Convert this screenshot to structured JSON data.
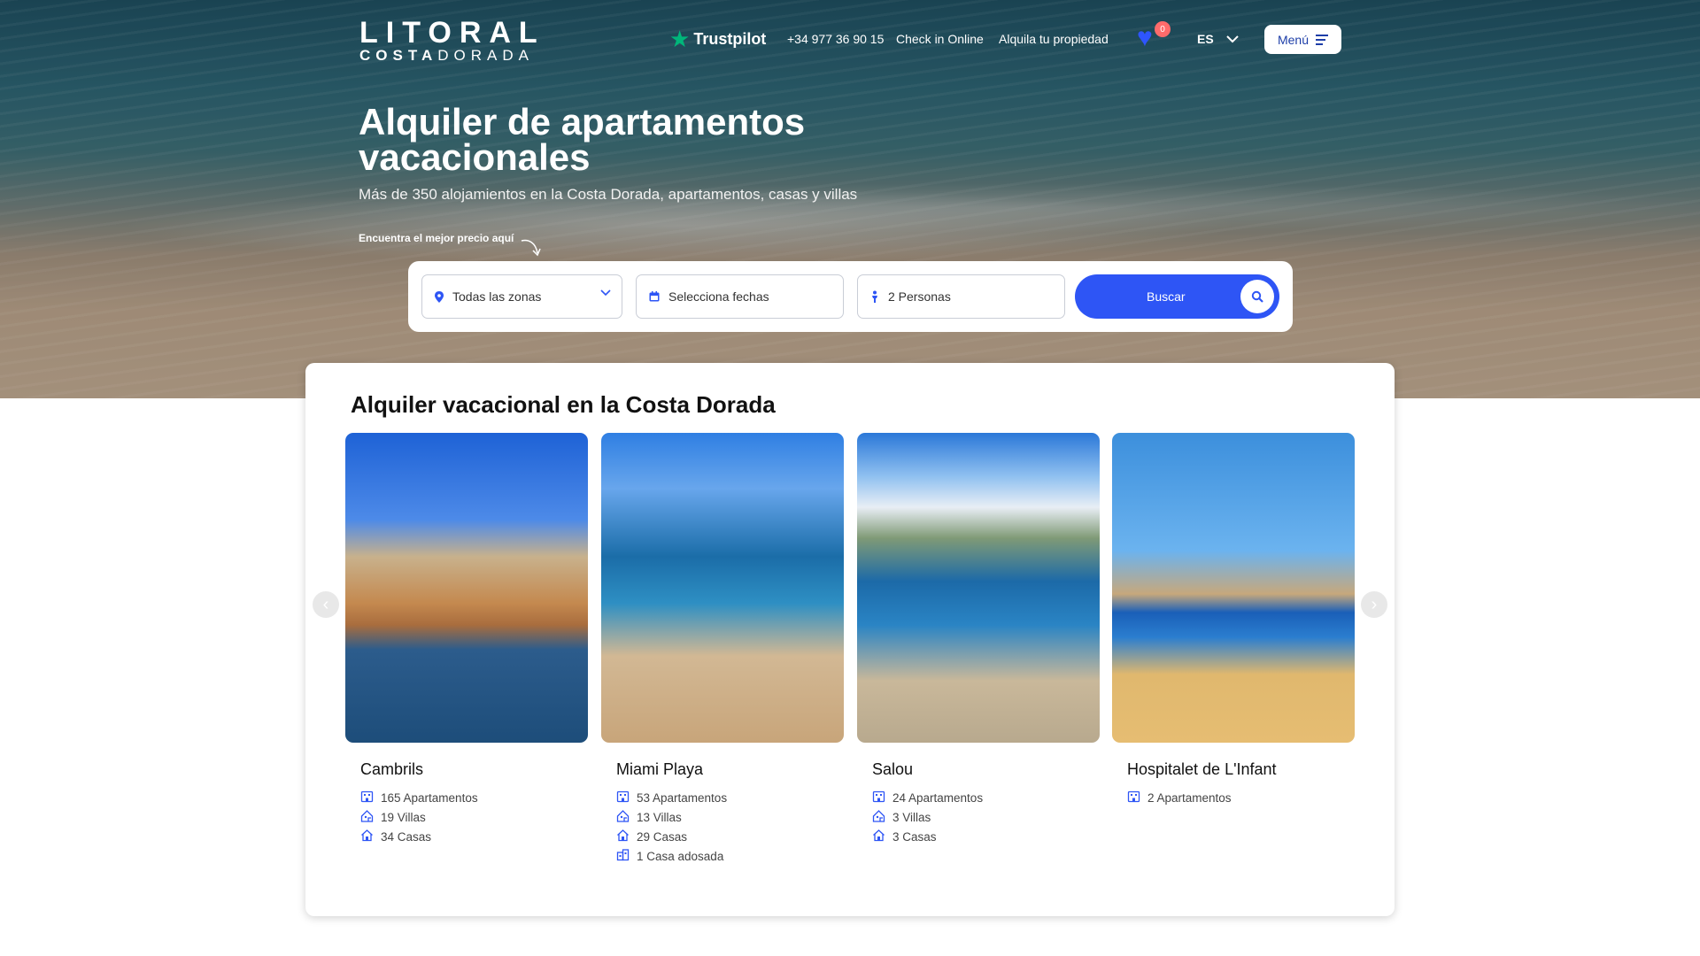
{
  "brand": {
    "logo_line1": "LITORAL",
    "logo_line2_bold": "COSTA",
    "logo_line2_light": "DORADA"
  },
  "nav": {
    "trustpilot": "Trustpilot",
    "phone": "+34 977 36 90 15",
    "checkin": "Check in Online",
    "rent_property": "Alquila tu propiedad",
    "favorites_count": "0",
    "language": "ES",
    "menu": "Menú"
  },
  "hero": {
    "title": "Alquiler de apartamentos vacacionales",
    "subtitle": "Más de 350 alojamientos en la Costa Dorada, apartamentos, casas y villas",
    "hint": "Encuentra el mejor precio aquí"
  },
  "search": {
    "zone": "Todas las zonas",
    "dates": "Selecciona fechas",
    "people": "2 Personas",
    "button": "Buscar"
  },
  "section": {
    "title": "Alquiler vacacional en la Costa Dorada",
    "cards": [
      {
        "name": "Cambrils",
        "items": [
          {
            "icon": "apartment-icon",
            "text": "165 Apartamentos"
          },
          {
            "icon": "villa-icon",
            "text": "19 Villas"
          },
          {
            "icon": "house-icon",
            "text": "34 Casas"
          }
        ]
      },
      {
        "name": "Miami Playa",
        "items": [
          {
            "icon": "apartment-icon",
            "text": "53 Apartamentos"
          },
          {
            "icon": "villa-icon",
            "text": "13 Villas"
          },
          {
            "icon": "house-icon",
            "text": "29 Casas"
          },
          {
            "icon": "townhouse-icon",
            "text": "1 Casa adosada"
          }
        ]
      },
      {
        "name": "Salou",
        "items": [
          {
            "icon": "apartment-icon",
            "text": "24 Apartamentos"
          },
          {
            "icon": "villa-icon",
            "text": "3 Villas"
          },
          {
            "icon": "house-icon",
            "text": "3 Casas"
          }
        ]
      },
      {
        "name": "Hospitalet de L'Infant",
        "items": [
          {
            "icon": "apartment-icon",
            "text": "2 Apartamentos"
          }
        ]
      }
    ]
  },
  "colors": {
    "accent": "#2e55f5",
    "trustpilot_star": "#00b67a",
    "badge": "#ff6b6b"
  }
}
